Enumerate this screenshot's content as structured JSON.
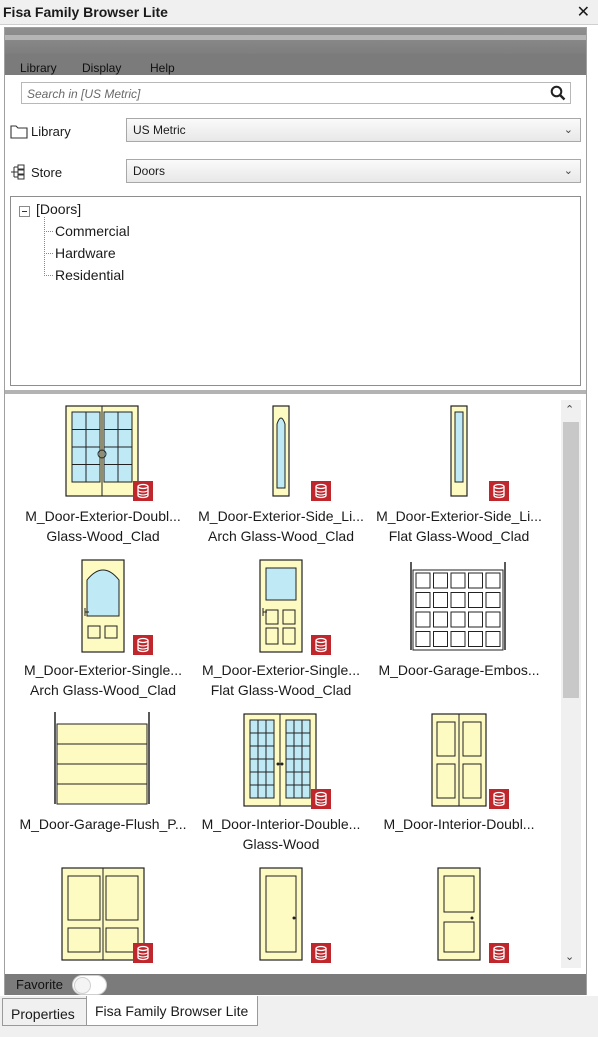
{
  "window": {
    "title": "Fisa Family Browser Lite",
    "close_glyph": "✕"
  },
  "menu": [
    "Library",
    "Display",
    "Help"
  ],
  "search": {
    "placeholder": "Search in [US Metric]",
    "icon": "search-icon"
  },
  "library": {
    "label": "Library",
    "value": "US Metric",
    "icon": "folder-icon"
  },
  "store": {
    "label": "Store",
    "value": "Doors",
    "icon": "hierarchy-icon"
  },
  "tree": {
    "root": "[Doors]",
    "children": [
      "Commercial",
      "Hardware",
      "Residential"
    ]
  },
  "items": [
    {
      "line1": "M_Door-Exterior-Doubl...",
      "line2": "Glass-Wood_Clad",
      "kind": "double-glass",
      "badge": true
    },
    {
      "line1": "M_Door-Exterior-Side_Li...",
      "line2": "Arch Glass-Wood_Clad",
      "kind": "side-arch",
      "badge": true
    },
    {
      "line1": "M_Door-Exterior-Side_Li...",
      "line2": "Flat Glass-Wood_Clad",
      "kind": "side-flat",
      "badge": true
    },
    {
      "line1": "M_Door-Exterior-Single...",
      "line2": "Arch Glass-Wood_Clad",
      "kind": "single-arch",
      "badge": true
    },
    {
      "line1": "M_Door-Exterior-Single...",
      "line2": "Flat Glass-Wood_Clad",
      "kind": "single-flat",
      "badge": true
    },
    {
      "line1": "M_Door-Garage-Embos...",
      "line2": "",
      "kind": "garage-emboss",
      "badge": false
    },
    {
      "line1": "M_Door-Garage-Flush_P...",
      "line2": "",
      "kind": "garage-flush",
      "badge": false
    },
    {
      "line1": "M_Door-Interior-Double...",
      "line2": "Glass-Wood",
      "kind": "interior-double-glass",
      "badge": true
    },
    {
      "line1": "M_Door-Interior-Doubl...",
      "line2": "",
      "kind": "interior-double-panel",
      "badge": true
    },
    {
      "line1": "",
      "line2": "",
      "kind": "double-four-panel",
      "badge": true
    },
    {
      "line1": "",
      "line2": "",
      "kind": "single-one-panel",
      "badge": true
    },
    {
      "line1": "",
      "line2": "",
      "kind": "single-two-panel",
      "badge": true
    }
  ],
  "favorite": {
    "label": "Favorite",
    "on": false
  },
  "tabs": [
    {
      "label": "Properties",
      "active": false
    },
    {
      "label": "Fisa Family Browser Lite",
      "active": true
    }
  ],
  "colors": {
    "door_fill": "#fdfbc2",
    "glass": "#bfeaf5",
    "badge": "#c0272d",
    "toolbar": "#7b7b7b"
  }
}
